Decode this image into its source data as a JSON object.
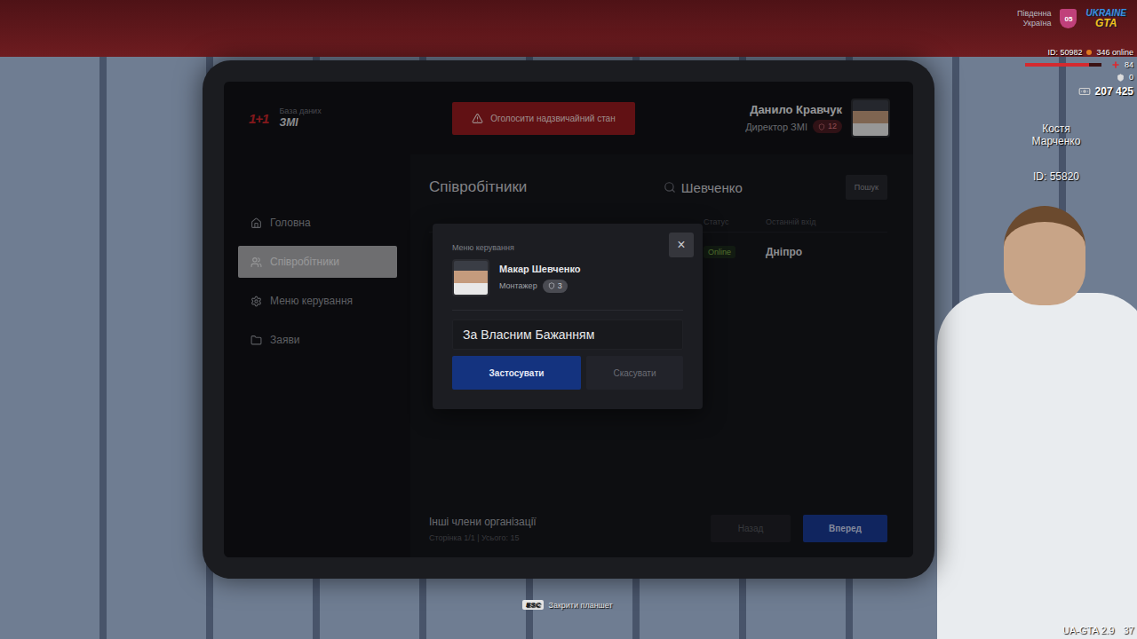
{
  "hud": {
    "server_lines": [
      "Південна",
      "Україна"
    ],
    "server_badge": "05",
    "logo_top": "UKRAINE",
    "logo_bottom": "GTA",
    "id": "ID: 50982",
    "online": "346 online",
    "health": "84",
    "health_level": 0.84,
    "armor": "0",
    "money": "207 425"
  },
  "player_tag": {
    "name_lines": [
      "Костя",
      "Марченко"
    ],
    "id": "ID: 55820"
  },
  "tablet": {
    "logo": "1+1",
    "db_label": "База даних",
    "db_title": "ЗМІ",
    "emergency_button": "Оголосити надзвичайний стан",
    "user": {
      "name": "Данило Кравчук",
      "role": "Директор ЗМІ",
      "rank": "12"
    },
    "sidebar": [
      {
        "label": "Головна",
        "selected": false
      },
      {
        "label": "Співробітники",
        "selected": true
      },
      {
        "label": "Меню керування",
        "selected": false
      },
      {
        "label": "Заяви",
        "selected": false
      }
    ],
    "page_title": "Співробітники",
    "search": {
      "value": "Шевченко",
      "button": "Пошук"
    },
    "table": {
      "columns": [
        "Статус",
        "Останній вхід"
      ],
      "rows": [
        {
          "status": "Online",
          "last_seen": "Дніпро"
        }
      ]
    },
    "footer": {
      "title": "Інші члени організації",
      "info": "Сторінка 1/1 | Усього: 15",
      "prev": "Назад",
      "next": "Вперед"
    },
    "modal": {
      "title": "Меню керування",
      "close": "×",
      "employee": {
        "name": "Макар Шевченко",
        "role": "Монтажер",
        "rank": "3"
      },
      "input_value": "За Власним Бажанням",
      "apply": "Застосувати",
      "cancel": "Скасувати"
    }
  },
  "close_hint": {
    "key": "ESC",
    "label": "Закрити планшет"
  },
  "version": {
    "text": "UA-GTA 2.9",
    "fps": "37"
  }
}
